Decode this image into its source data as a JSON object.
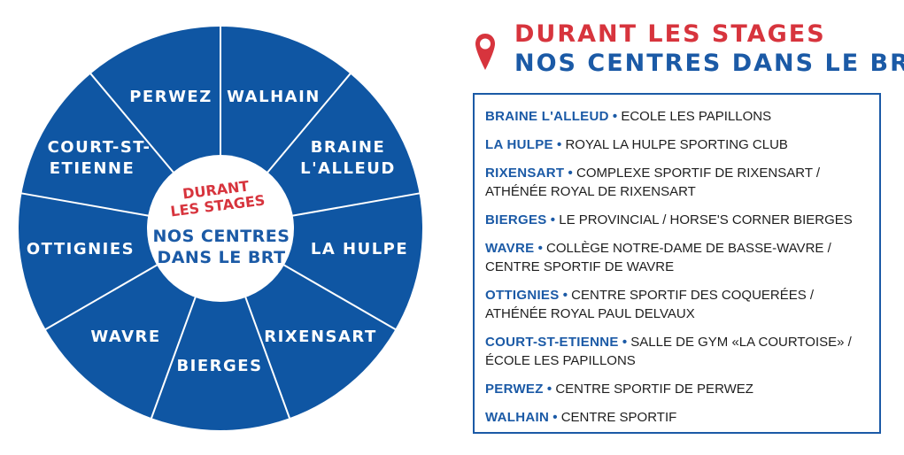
{
  "wheel": {
    "segments": [
      "PERWEZ",
      "WALHAIN",
      "BRAINE",
      "L'ALLEUD",
      "LA HULPE",
      "RIXENSART",
      "BIERGES",
      "WAVRE",
      "OTTIGNIES",
      "COURT-ST-",
      "ETIENNE"
    ],
    "center_red_1": "DURANT",
    "center_red_2": "LES STAGES",
    "center_blue_1": "NOS CENTRES",
    "center_blue_2": "DANS LE BRT",
    "colors": {
      "fill": "#0f56a3",
      "divider": "#ffffff",
      "center": "#ffffff"
    }
  },
  "heading": {
    "line1": "DURANT LES STAGES",
    "line2": "NOS CENTRES DANS LE BRT",
    "icon": "map-pin-icon",
    "colors": {
      "red": "#d7343d",
      "blue": "#1b5aa6"
    }
  },
  "centres": [
    {
      "city": "BRAINE L'ALLEUD",
      "sep": "•",
      "venue": "ECOLE LES PAPILLONS"
    },
    {
      "city": "LA HULPE",
      "sep": "•",
      "venue": "ROYAL LA HULPE SPORTING CLUB"
    },
    {
      "city": "RIXENSART",
      "sep": "•",
      "venue": "COMPLEXE SPORTIF DE RIXENSART / ATHÉNÉE ROYAL DE RIXENSART"
    },
    {
      "city": "BIERGES",
      "sep": "•",
      "venue": "LE PROVINCIAL / HORSE'S CORNER BIERGES"
    },
    {
      "city": "WAVRE",
      "sep": "•",
      "venue": "COLLÈGE NOTRE-DAME DE BASSE-WAVRE / CENTRE SPORTIF DE WAVRE"
    },
    {
      "city": "OTTIGNIES",
      "sep": "•",
      "venue": "CENTRE SPORTIF DES COQUERÉES / ATHÉNÉE ROYAL PAUL DELVAUX"
    },
    {
      "city": "COURT-ST-ETIENNE",
      "sep": "•",
      "venue": "SALLE DE GYM «LA COURTOISE» / ÉCOLE LES PAPILLONS"
    },
    {
      "city": "PERWEZ",
      "sep": "•",
      "venue": "CENTRE SPORTIF DE PERWEZ"
    },
    {
      "city": "WALHAIN",
      "sep": "•",
      "venue": "CENTRE SPORTIF"
    }
  ]
}
